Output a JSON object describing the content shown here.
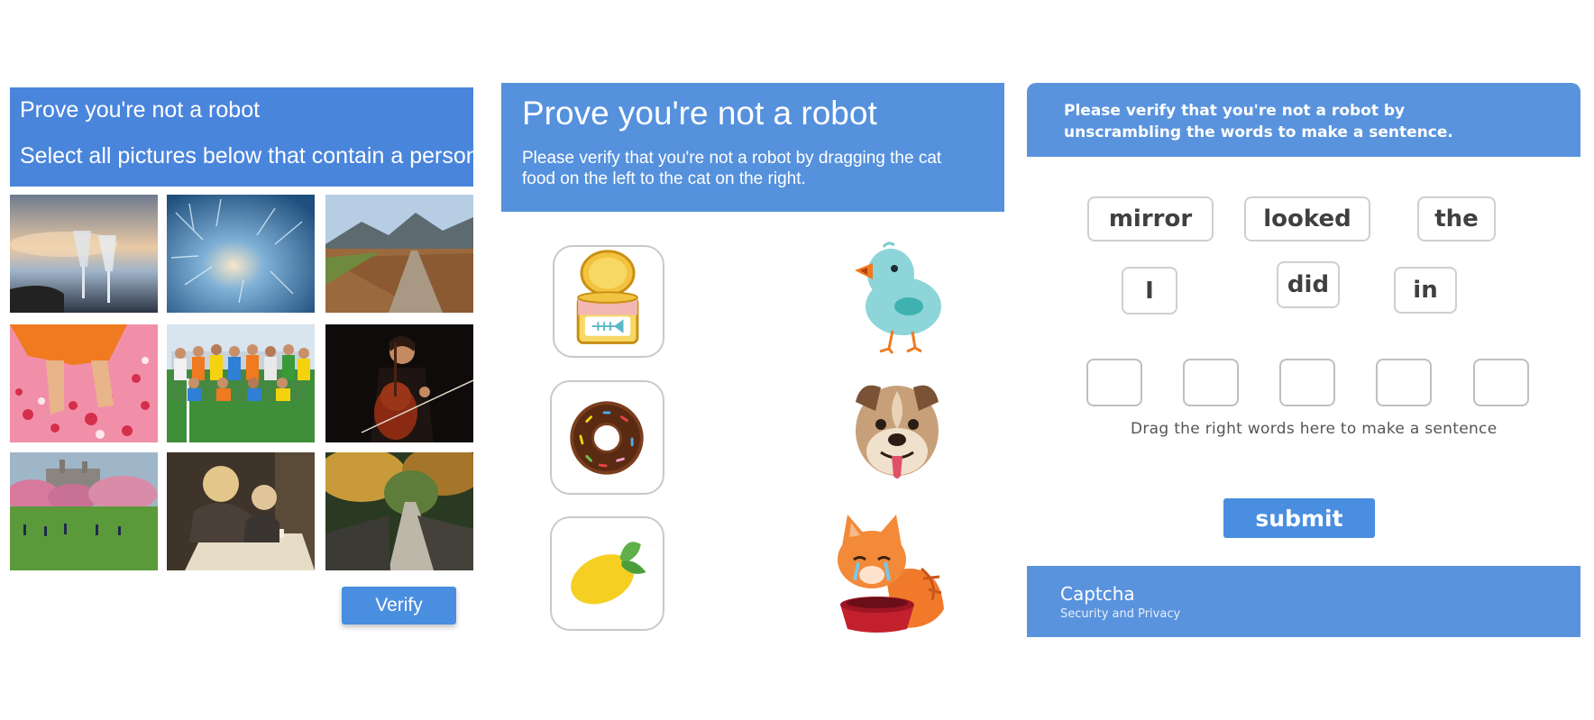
{
  "panel1": {
    "title": "Prove you're not a robot",
    "instruction": "Select all pictures below that contain a person",
    "tiles": [
      {
        "subject": "champagne glasses at sunset"
      },
      {
        "subject": "frost on window"
      },
      {
        "subject": "dirt road in field"
      },
      {
        "subject": "feet walking on rose petals"
      },
      {
        "subject": "sports team group photo"
      },
      {
        "subject": "cellist playing"
      },
      {
        "subject": "park with trees and people"
      },
      {
        "subject": "children reading"
      },
      {
        "subject": "forest path"
      }
    ],
    "verify_label": "Verify",
    "colors": {
      "header": "#4a85dc",
      "button": "#4a8ee0"
    }
  },
  "panel2": {
    "title": "Prove you're not a robot",
    "description": "Please verify that you're not a robot by dragging the cat food on the left to the cat on the right.",
    "items": [
      {
        "icon": "cat-food-can-icon"
      },
      {
        "icon": "donut-icon"
      },
      {
        "icon": "lemon-icon"
      }
    ],
    "animals": [
      {
        "icon": "bird-icon"
      },
      {
        "icon": "dog-icon"
      },
      {
        "icon": "cat-icon"
      }
    ],
    "colors": {
      "header": "#5591dc"
    }
  },
  "panel3": {
    "description": "Please verify that you're not a robot by unscrambling the words to make a sentence.",
    "words": [
      "mirror",
      "looked",
      "the",
      "I",
      "did",
      "in"
    ],
    "slot_count": 5,
    "hint": "Drag the right words here to make a sentence",
    "submit_label": "submit",
    "footer": {
      "brand": "Captcha",
      "tagline": "Security and Privacy"
    },
    "colors": {
      "header": "#5a93dd",
      "button": "#4a8ee0"
    }
  }
}
